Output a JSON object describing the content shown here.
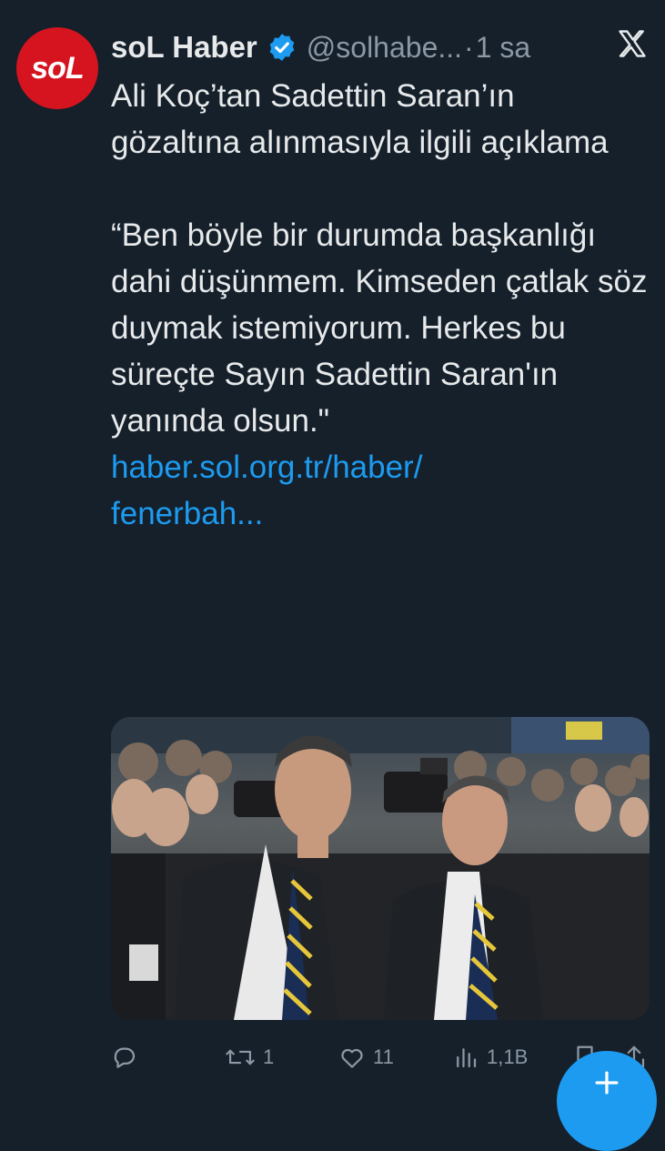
{
  "account": {
    "display_name": "soL Haber",
    "handle": "@solhabe...",
    "separator": "·",
    "time": "1 sa",
    "avatar_text": "soL"
  },
  "tweet": {
    "line1": "Ali Koç’tan Sadettin Saran’ın gözaltına alınmasıyla ilgili açıklama",
    "quote": "“Ben böyle bir durumda başkanlığı dahi düşünmem. Kimseden çatlak söz duymak istemiyorum. Herkes bu süreçte Sayın Sadettin Saran'ın yanında olsun.\"",
    "link_line1": "haber.sol.org.tr/haber/",
    "link_line2": "fenerbah..."
  },
  "actions": {
    "replies": "",
    "retweets": "1",
    "likes": "11",
    "views": "1,1B"
  },
  "colors": {
    "background": "#15202b",
    "accent": "#1d9bf0",
    "muted": "#8b98a5",
    "brand_red": "#d6141f"
  },
  "icons": [
    "verified-badge-icon",
    "x-logo-icon",
    "reply-icon",
    "retweet-icon",
    "like-icon",
    "views-icon",
    "bookmark-icon",
    "share-icon",
    "plus-icon"
  ]
}
